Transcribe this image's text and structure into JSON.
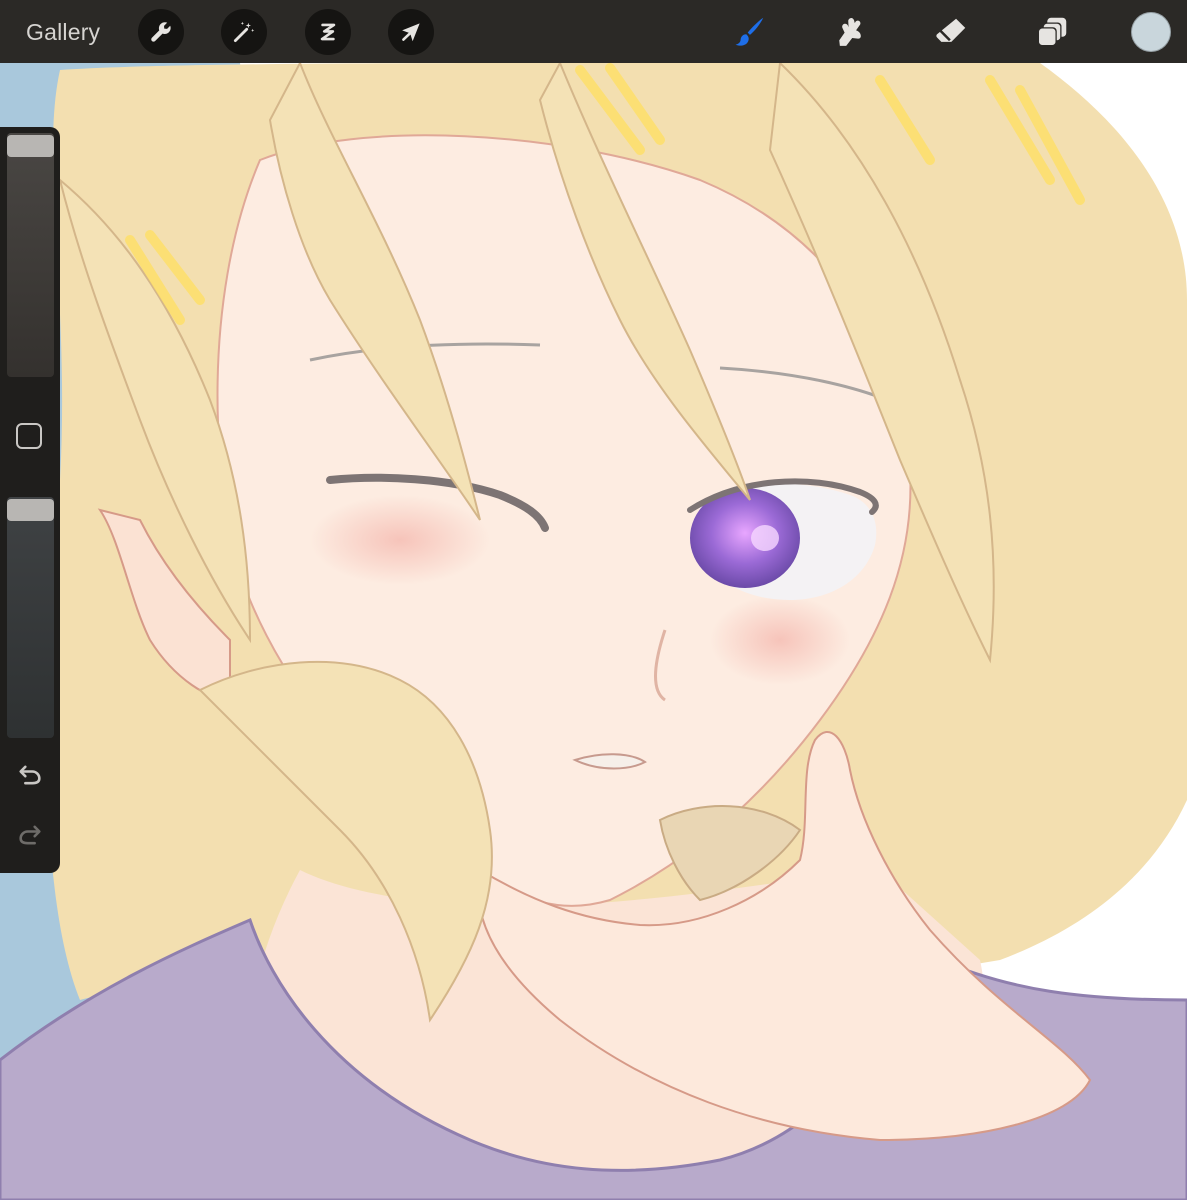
{
  "toolbar": {
    "gallery_label": "Gallery",
    "left_tools": [
      {
        "icon": "wrench-icon",
        "name": "actions"
      },
      {
        "icon": "magic-wand-icon",
        "name": "adjustments"
      },
      {
        "icon": "selection-s-icon",
        "name": "selection"
      },
      {
        "icon": "arrow-cursor-icon",
        "name": "transform"
      }
    ],
    "right_tools": [
      {
        "icon": "brush-icon",
        "name": "paint",
        "active": true
      },
      {
        "icon": "smudge-icon",
        "name": "smudge",
        "active": false
      },
      {
        "icon": "eraser-icon",
        "name": "erase",
        "active": false
      },
      {
        "icon": "layers-icon",
        "name": "layers",
        "active": false
      }
    ],
    "current_color": "#c9d6dc"
  },
  "sidebar": {
    "brush_size_level": 1.0,
    "brush_opacity_level": 1.0,
    "modifier_icon": "square-icon",
    "undo_icon": "undo-arrow-icon",
    "redo_icon": "redo-arrow-icon"
  },
  "colors": {
    "toolbar_bg": "#2b2926",
    "active_tool": "#1e6ee8",
    "inactive_tool": "#e6e4e1",
    "hair": "#f3dfb0",
    "skin": "#fcece1",
    "shirt": "#b8aacb",
    "eye": "#9b6ad6",
    "background_blue": "#a9c8dc"
  }
}
